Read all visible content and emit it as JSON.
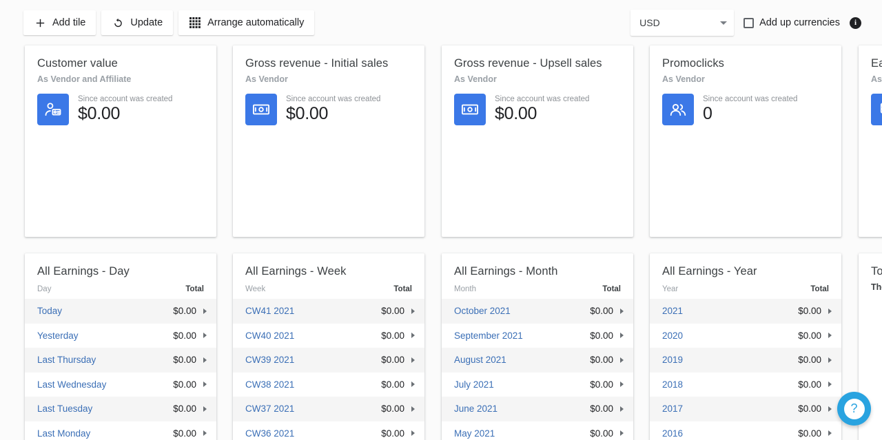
{
  "toolbar": {
    "buttons": [
      {
        "label": "Add tile",
        "icon": "plus-icon"
      },
      {
        "label": "Update",
        "icon": "refresh-icon"
      },
      {
        "label": "Arrange automatically",
        "icon": "grid-icon"
      }
    ],
    "currency": {
      "value": "USD",
      "icon": "chevron-down-icon"
    },
    "add_up_currencies": {
      "label": "Add up currencies",
      "checked": false,
      "info_icon": "info-icon",
      "info_glyph": "i"
    }
  },
  "colors": {
    "icon_blue": "#3b78e7",
    "link_blue": "#3b6fb6",
    "help_blue": "#29a3e0",
    "page_bg": "#fbfbfb",
    "row_stripe": "#f5f5f5"
  },
  "stat_tiles": [
    {
      "title": "Customer value",
      "subtitle": "As Vendor and Affiliate",
      "period": "Since account was created",
      "value": "$0.00",
      "icon": "person-card-icon"
    },
    {
      "title": "Gross revenue - Initial sales",
      "subtitle": "As Vendor",
      "period": "Since account was created",
      "value": "$0.00",
      "icon": "banknote-icon"
    },
    {
      "title": "Gross revenue - Upsell sales",
      "subtitle": "As Vendor",
      "period": "Since account was created",
      "value": "$0.00",
      "icon": "banknote-icon"
    },
    {
      "title": "Promoclicks",
      "subtitle": "As Vendor",
      "period": "Since account was created",
      "value": "0",
      "icon": "people-icon"
    }
  ],
  "stat_tile_partial": {
    "title": "Ea",
    "subtitle": "As ",
    "icon": "coins-stack-icon"
  },
  "table_tiles": [
    {
      "title": "All Earnings - Day",
      "col_left": "Day",
      "col_right": "Total",
      "rows": [
        {
          "label": "Today",
          "value": "$0.00"
        },
        {
          "label": "Yesterday",
          "value": "$0.00"
        },
        {
          "label": "Last Thursday",
          "value": "$0.00"
        },
        {
          "label": "Last Wednesday",
          "value": "$0.00"
        },
        {
          "label": "Last Tuesday",
          "value": "$0.00"
        },
        {
          "label": "Last Monday",
          "value": "$0.00"
        }
      ]
    },
    {
      "title": "All Earnings - Week",
      "col_left": "Week",
      "col_right": "Total",
      "rows": [
        {
          "label": "CW41 2021",
          "value": "$0.00"
        },
        {
          "label": "CW40 2021",
          "value": "$0.00"
        },
        {
          "label": "CW39 2021",
          "value": "$0.00"
        },
        {
          "label": "CW38 2021",
          "value": "$0.00"
        },
        {
          "label": "CW37 2021",
          "value": "$0.00"
        },
        {
          "label": "CW36 2021",
          "value": "$0.00"
        }
      ]
    },
    {
      "title": "All Earnings - Month",
      "col_left": "Month",
      "col_right": "Total",
      "rows": [
        {
          "label": "October 2021",
          "value": "$0.00"
        },
        {
          "label": "September 2021",
          "value": "$0.00"
        },
        {
          "label": "August 2021",
          "value": "$0.00"
        },
        {
          "label": "July 2021",
          "value": "$0.00"
        },
        {
          "label": "June 2021",
          "value": "$0.00"
        },
        {
          "label": "May 2021",
          "value": "$0.00"
        }
      ]
    },
    {
      "title": "All Earnings - Year",
      "col_left": "Year",
      "col_right": "Total",
      "rows": [
        {
          "label": "2021",
          "value": "$0.00"
        },
        {
          "label": "2020",
          "value": "$0.00"
        },
        {
          "label": "2019",
          "value": "$0.00"
        },
        {
          "label": "2018",
          "value": "$0.00"
        },
        {
          "label": "2017",
          "value": "$0.00"
        },
        {
          "label": "2016",
          "value": "$0.00"
        }
      ]
    }
  ],
  "table_tile_partial": {
    "title": "Top",
    "subtitle": "The"
  },
  "help": {
    "glyph": "?",
    "icon": "question-mark-icon"
  }
}
